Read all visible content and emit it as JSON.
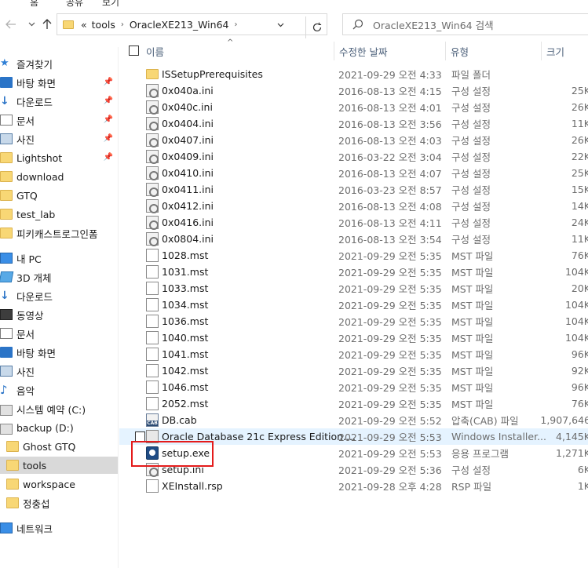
{
  "ribbon": {
    "items": [
      "홈",
      "공유",
      "보기"
    ]
  },
  "address": {
    "overflow": "«",
    "crumbs": [
      "tools",
      "OracleXE213_Win64"
    ],
    "search_placeholder": "OracleXE213_Win64 검색"
  },
  "sidebar": {
    "items": [
      {
        "label": "즐겨찾기",
        "icon": "star-icon"
      },
      {
        "label": "바탕 화면",
        "icon": "desktop-icon",
        "pinned": true
      },
      {
        "label": "다운로드",
        "icon": "download-icon",
        "pinned": true
      },
      {
        "label": "문서",
        "icon": "document-icon",
        "pinned": true
      },
      {
        "label": "사진",
        "icon": "picture-icon",
        "pinned": true
      },
      {
        "label": "Lightshot",
        "icon": "folder-icon",
        "pinned": true
      },
      {
        "label": "download",
        "icon": "folder-icon"
      },
      {
        "label": "GTQ",
        "icon": "folder-icon"
      },
      {
        "label": "test_lab",
        "icon": "folder-icon"
      },
      {
        "label": "피키캐스트로그인폼",
        "icon": "folder-icon"
      },
      {
        "label": "내 PC",
        "icon": "pc-icon"
      },
      {
        "label": "3D 개체",
        "icon": "3d-objects-icon"
      },
      {
        "label": "다운로드",
        "icon": "download-icon"
      },
      {
        "label": "동영상",
        "icon": "video-icon"
      },
      {
        "label": "문서",
        "icon": "document-icon"
      },
      {
        "label": "바탕 화면",
        "icon": "desktop-icon"
      },
      {
        "label": "사진",
        "icon": "picture-icon"
      },
      {
        "label": "음악",
        "icon": "music-icon"
      },
      {
        "label": "시스템 예약 (C:)",
        "icon": "drive-icon"
      },
      {
        "label": "backup (D:)",
        "icon": "drive-icon"
      },
      {
        "label": "Ghost GTQ",
        "icon": "folder-icon"
      },
      {
        "label": "tools",
        "icon": "folder-icon",
        "selected": true
      },
      {
        "label": "workspace",
        "icon": "folder-icon"
      },
      {
        "label": "정충섭",
        "icon": "folder-icon"
      },
      {
        "label": "네트워크",
        "icon": "network-icon"
      }
    ]
  },
  "columns": {
    "name": "이름",
    "date": "수정한 날짜",
    "type": "유형",
    "size": "크기"
  },
  "files": [
    {
      "name": "ISSetupPrerequisites",
      "date": "2021-09-29 오전 4:33",
      "type": "파일 폴더",
      "size": "",
      "kind": "folder"
    },
    {
      "name": "0x040a.ini",
      "date": "2016-08-13 오전 4:15",
      "type": "구성 설정",
      "size": "25K",
      "kind": "ini"
    },
    {
      "name": "0x040c.ini",
      "date": "2016-08-13 오전 4:01",
      "type": "구성 설정",
      "size": "26K",
      "kind": "ini"
    },
    {
      "name": "0x0404.ini",
      "date": "2016-08-13 오전 3:56",
      "type": "구성 설정",
      "size": "11K",
      "kind": "ini"
    },
    {
      "name": "0x0407.ini",
      "date": "2016-08-13 오전 4:03",
      "type": "구성 설정",
      "size": "26K",
      "kind": "ini"
    },
    {
      "name": "0x0409.ini",
      "date": "2016-03-22 오전 3:04",
      "type": "구성 설정",
      "size": "22K",
      "kind": "ini"
    },
    {
      "name": "0x0410.ini",
      "date": "2016-08-13 오전 4:07",
      "type": "구성 설정",
      "size": "25K",
      "kind": "ini"
    },
    {
      "name": "0x0411.ini",
      "date": "2016-03-23 오전 8:57",
      "type": "구성 설정",
      "size": "15K",
      "kind": "ini"
    },
    {
      "name": "0x0412.ini",
      "date": "2016-08-13 오전 4:08",
      "type": "구성 설정",
      "size": "14K",
      "kind": "ini"
    },
    {
      "name": "0x0416.ini",
      "date": "2016-08-13 오전 4:11",
      "type": "구성 설정",
      "size": "24K",
      "kind": "ini"
    },
    {
      "name": "0x0804.ini",
      "date": "2016-08-13 오전 3:54",
      "type": "구성 설정",
      "size": "11K",
      "kind": "ini"
    },
    {
      "name": "1028.mst",
      "date": "2021-09-29 오전 5:35",
      "type": "MST 파일",
      "size": "76K",
      "kind": "file"
    },
    {
      "name": "1031.mst",
      "date": "2021-09-29 오전 5:35",
      "type": "MST 파일",
      "size": "104K",
      "kind": "file"
    },
    {
      "name": "1033.mst",
      "date": "2021-09-29 오전 5:35",
      "type": "MST 파일",
      "size": "20K",
      "kind": "file"
    },
    {
      "name": "1034.mst",
      "date": "2021-09-29 오전 5:35",
      "type": "MST 파일",
      "size": "104K",
      "kind": "file"
    },
    {
      "name": "1036.mst",
      "date": "2021-09-29 오전 5:35",
      "type": "MST 파일",
      "size": "104K",
      "kind": "file"
    },
    {
      "name": "1040.mst",
      "date": "2021-09-29 오전 5:35",
      "type": "MST 파일",
      "size": "104K",
      "kind": "file"
    },
    {
      "name": "1041.mst",
      "date": "2021-09-29 오전 5:35",
      "type": "MST 파일",
      "size": "96K",
      "kind": "file"
    },
    {
      "name": "1042.mst",
      "date": "2021-09-29 오전 5:35",
      "type": "MST 파일",
      "size": "92K",
      "kind": "file"
    },
    {
      "name": "1046.mst",
      "date": "2021-09-29 오전 5:35",
      "type": "MST 파일",
      "size": "96K",
      "kind": "file"
    },
    {
      "name": "2052.mst",
      "date": "2021-09-29 오전 5:35",
      "type": "MST 파일",
      "size": "76K",
      "kind": "file"
    },
    {
      "name": "DB.cab",
      "date": "2021-09-29 오전 5:52",
      "type": "압축(CAB) 파일",
      "size": "1,907,646",
      "kind": "cab"
    },
    {
      "name": "Oracle Database 21c Express Edition....",
      "date": "2021-09-29 오전 5:53",
      "type": "Windows Installer...",
      "size": "4,145K",
      "kind": "msi",
      "hover": true
    },
    {
      "name": "setup.exe",
      "date": "2021-09-29 오전 5:53",
      "type": "응용 프로그램",
      "size": "1,271K",
      "kind": "exe"
    },
    {
      "name": "setup.ini",
      "date": "2021-09-29 오전 5:36",
      "type": "구성 설정",
      "size": "6K",
      "kind": "ini"
    },
    {
      "name": "XEInstall.rsp",
      "date": "2021-09-28 오후 4:28",
      "type": "RSP 파일",
      "size": "1K",
      "kind": "file"
    }
  ],
  "colors": {
    "highlight": "#e41b1b",
    "selected": "#d9d9d9",
    "hover": "#e5f3ff",
    "header_text": "#4c607a"
  }
}
